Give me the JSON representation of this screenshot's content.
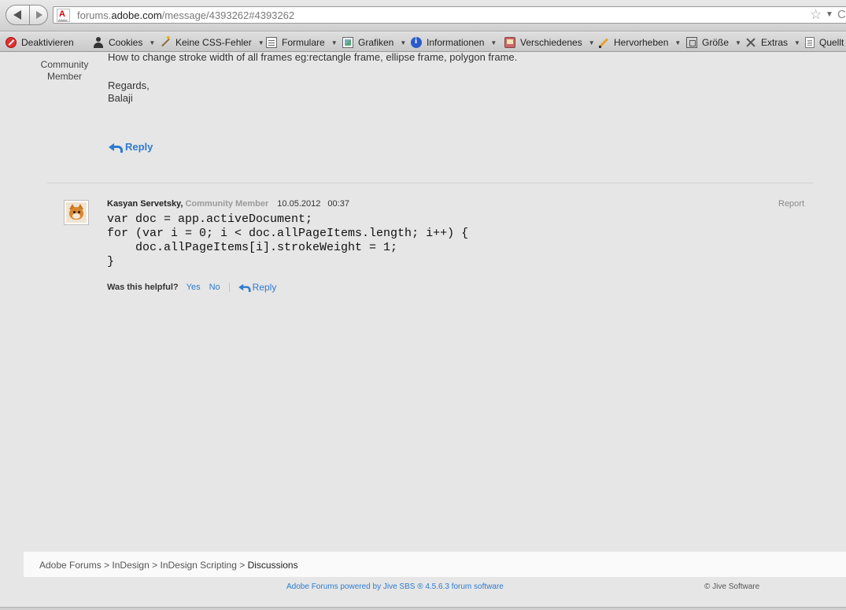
{
  "browser": {
    "url_prefix": "forums.",
    "url_host": "adobe.com",
    "url_path": "/message/4393262#4393262",
    "site_icon_letter": "A",
    "site_icon_sub": "Adobe"
  },
  "toolbar": {
    "items": [
      {
        "label": "Deaktivieren",
        "icon": "block-icon"
      },
      {
        "label": "Cookies",
        "icon": "person-icon"
      },
      {
        "label": "Keine CSS-Fehler",
        "icon": "wand-icon"
      },
      {
        "label": "Formulare",
        "icon": "form-icon"
      },
      {
        "label": "Grafiken",
        "icon": "image-icon"
      },
      {
        "label": "Informationen",
        "icon": "info-icon"
      },
      {
        "label": "Verschiedenes",
        "icon": "misc-icon"
      },
      {
        "label": "Hervorheben",
        "icon": "pencil-icon"
      },
      {
        "label": "Größe",
        "icon": "resize-icon"
      },
      {
        "label": "Extras",
        "icon": "tools-icon"
      },
      {
        "label": "Quellt",
        "icon": "page-icon"
      }
    ]
  },
  "original_post": {
    "author_role_line1": "Community",
    "author_role_line2": "Member",
    "text": "How to change stroke width of all frames eg:rectangle frame, ellipse frame, polygon frame.",
    "closing": "Regards,",
    "signature": "Balaji",
    "reply_label": "Reply"
  },
  "reply_post": {
    "author": "Kasyan Servetsky,",
    "role": "Community Member",
    "date": "10.05.2012",
    "time": "00:37",
    "report_label": "Report",
    "code_lines": [
      "var doc = app.activeDocument;",
      "for (var i = 0; i < doc.allPageItems.length; i++) {",
      "    doc.allPageItems[i].strokeWeight = 1;",
      "}"
    ],
    "helpful_question": "Was this helpful?",
    "yes_label": "Yes",
    "no_label": "No",
    "reply_label": "Reply"
  },
  "footer": {
    "breadcrumb": [
      {
        "label": "Adobe Forums"
      },
      {
        "label": "InDesign"
      },
      {
        "label": "InDesign Scripting"
      },
      {
        "label": "Discussions"
      }
    ],
    "separator": ">",
    "powered_by": "Adobe Forums powered by Jive SBS ® 4.5.6.3 forum software",
    "copyright": "© Jive Software"
  }
}
